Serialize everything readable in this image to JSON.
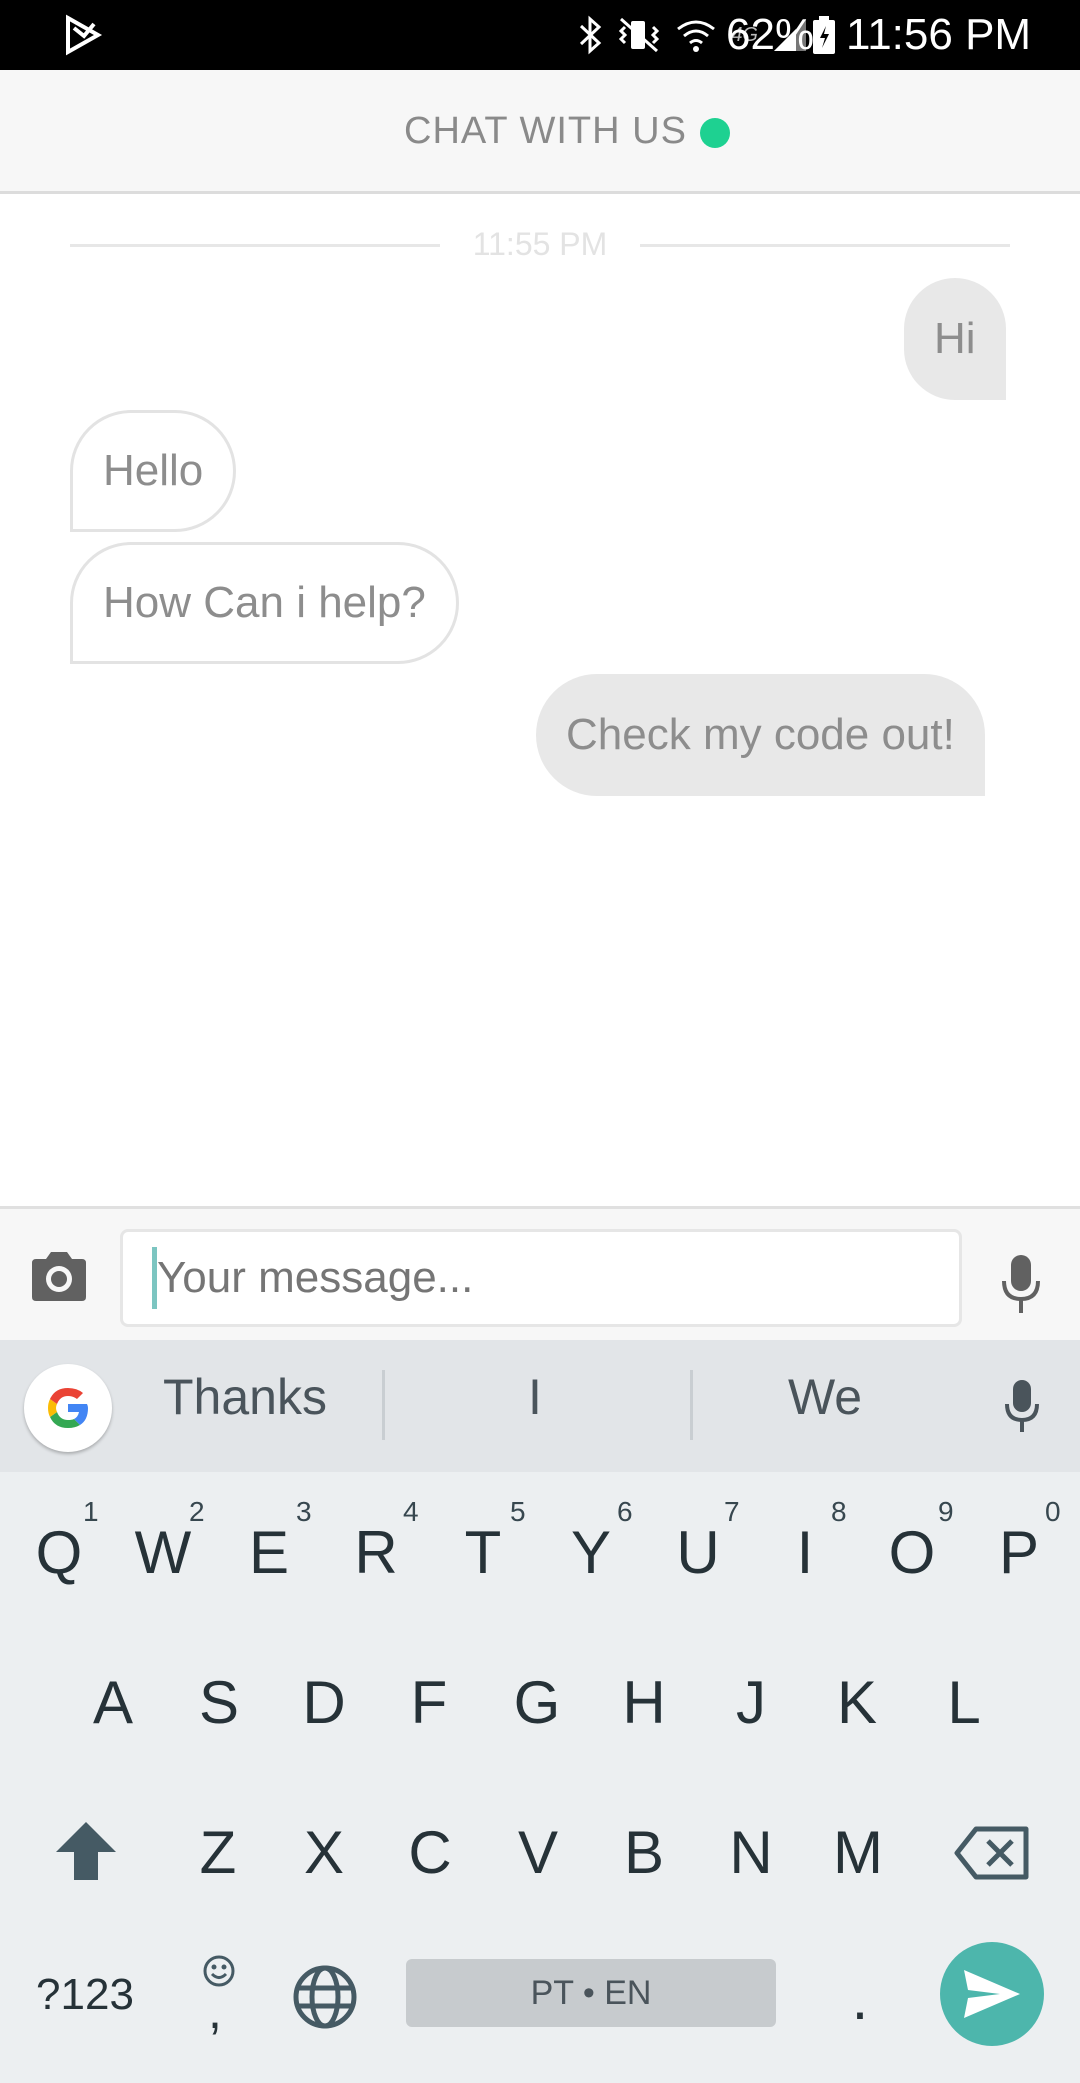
{
  "status_bar": {
    "battery_percent": "62%",
    "time": "11:56 PM",
    "network_label": "4G"
  },
  "header": {
    "title": "CHAT WITH US",
    "status_color": "#1ed191"
  },
  "conversation": {
    "timestamp": "11:55 PM",
    "messages": [
      {
        "direction": "out",
        "text": "Hi"
      },
      {
        "direction": "in",
        "text": "Hello"
      },
      {
        "direction": "in",
        "text": "How Can i help?"
      },
      {
        "direction": "out",
        "text": "Check my code out!"
      }
    ]
  },
  "composer": {
    "placeholder": "Your message..."
  },
  "keyboard": {
    "suggestions": [
      "Thanks",
      "I",
      "We"
    ],
    "row1": [
      "Q",
      "W",
      "E",
      "R",
      "T",
      "Y",
      "U",
      "I",
      "O",
      "P"
    ],
    "row1_hints": [
      "1",
      "2",
      "3",
      "4",
      "5",
      "6",
      "7",
      "8",
      "9",
      "0"
    ],
    "row2": [
      "A",
      "S",
      "D",
      "F",
      "G",
      "H",
      "J",
      "K",
      "L"
    ],
    "row3": [
      "Z",
      "X",
      "C",
      "V",
      "B",
      "N",
      "M"
    ],
    "symbols_key": "?123",
    "comma_key": ",",
    "period_key": ".",
    "space_label": "PT • EN",
    "accent_color": "#4db6ac"
  }
}
